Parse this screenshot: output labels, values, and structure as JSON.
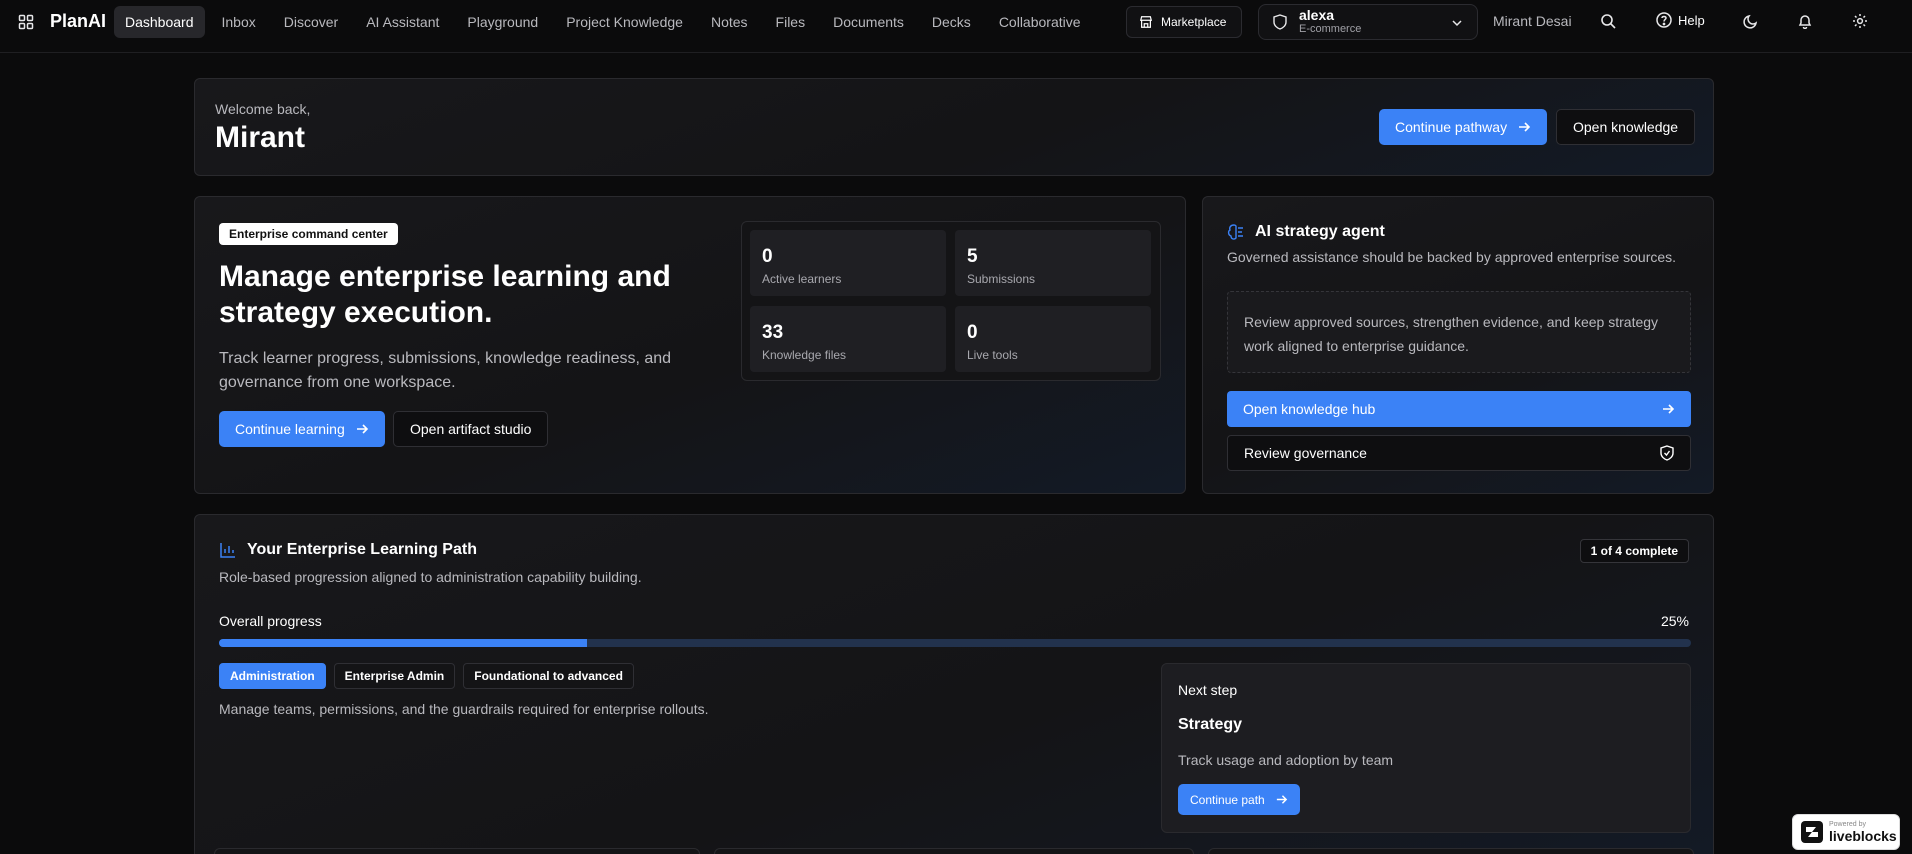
{
  "brand": "PlanAI",
  "nav": [
    "Dashboard",
    "Inbox",
    "Discover",
    "AI Assistant",
    "Playground",
    "Project Knowledge",
    "Notes",
    "Files",
    "Documents",
    "Decks",
    "Collaborative"
  ],
  "marketplace_label": "Marketplace",
  "workspace": {
    "name": "alexa",
    "type": "E-commerce"
  },
  "user_name": "Mirant Desai",
  "help_label": "Help",
  "welcome": {
    "greeting": "Welcome back,",
    "name": "Mirant",
    "continue_pathway": "Continue pathway",
    "open_knowledge": "Open knowledge"
  },
  "command_center": {
    "badge": "Enterprise command center",
    "heading": "Manage enterprise learning and strategy execution.",
    "description": "Track learner progress, submissions, knowledge readiness, and governance from one workspace.",
    "continue_learning": "Continue learning",
    "open_artifact_studio": "Open artifact studio",
    "stats": [
      {
        "value": "0",
        "label": "Active learners"
      },
      {
        "value": "5",
        "label": "Submissions"
      },
      {
        "value": "33",
        "label": "Knowledge files"
      },
      {
        "value": "0",
        "label": "Live tools"
      }
    ]
  },
  "agent": {
    "title": "AI strategy agent",
    "subtitle": "Governed assistance should be backed by approved enterprise sources.",
    "note": "Review approved sources, strengthen evidence, and keep strategy work aligned to enterprise guidance.",
    "open_hub": "Open knowledge hub",
    "review_governance": "Review governance"
  },
  "learning_path": {
    "title": "Your Enterprise Learning Path",
    "subtitle": "Role-based progression aligned to administration capability building.",
    "badge": "1 of 4 complete",
    "progress_label": "Overall progress",
    "progress_pct": "25%",
    "progress_value": 0.25,
    "tags": [
      "Administration",
      "Enterprise Admin",
      "Foundational to advanced"
    ],
    "description": "Manage teams, permissions, and the guardrails required for enterprise rollouts.",
    "next_step": {
      "label": "Next step",
      "title": "Strategy",
      "description": "Track usage and adoption by team",
      "button": "Continue path"
    }
  },
  "liveblocks": {
    "powered": "Powered by",
    "name": "liveblocks"
  },
  "colors": {
    "accent": "#3b82f6",
    "background": "#0b0b0c",
    "track": "#22324d"
  }
}
